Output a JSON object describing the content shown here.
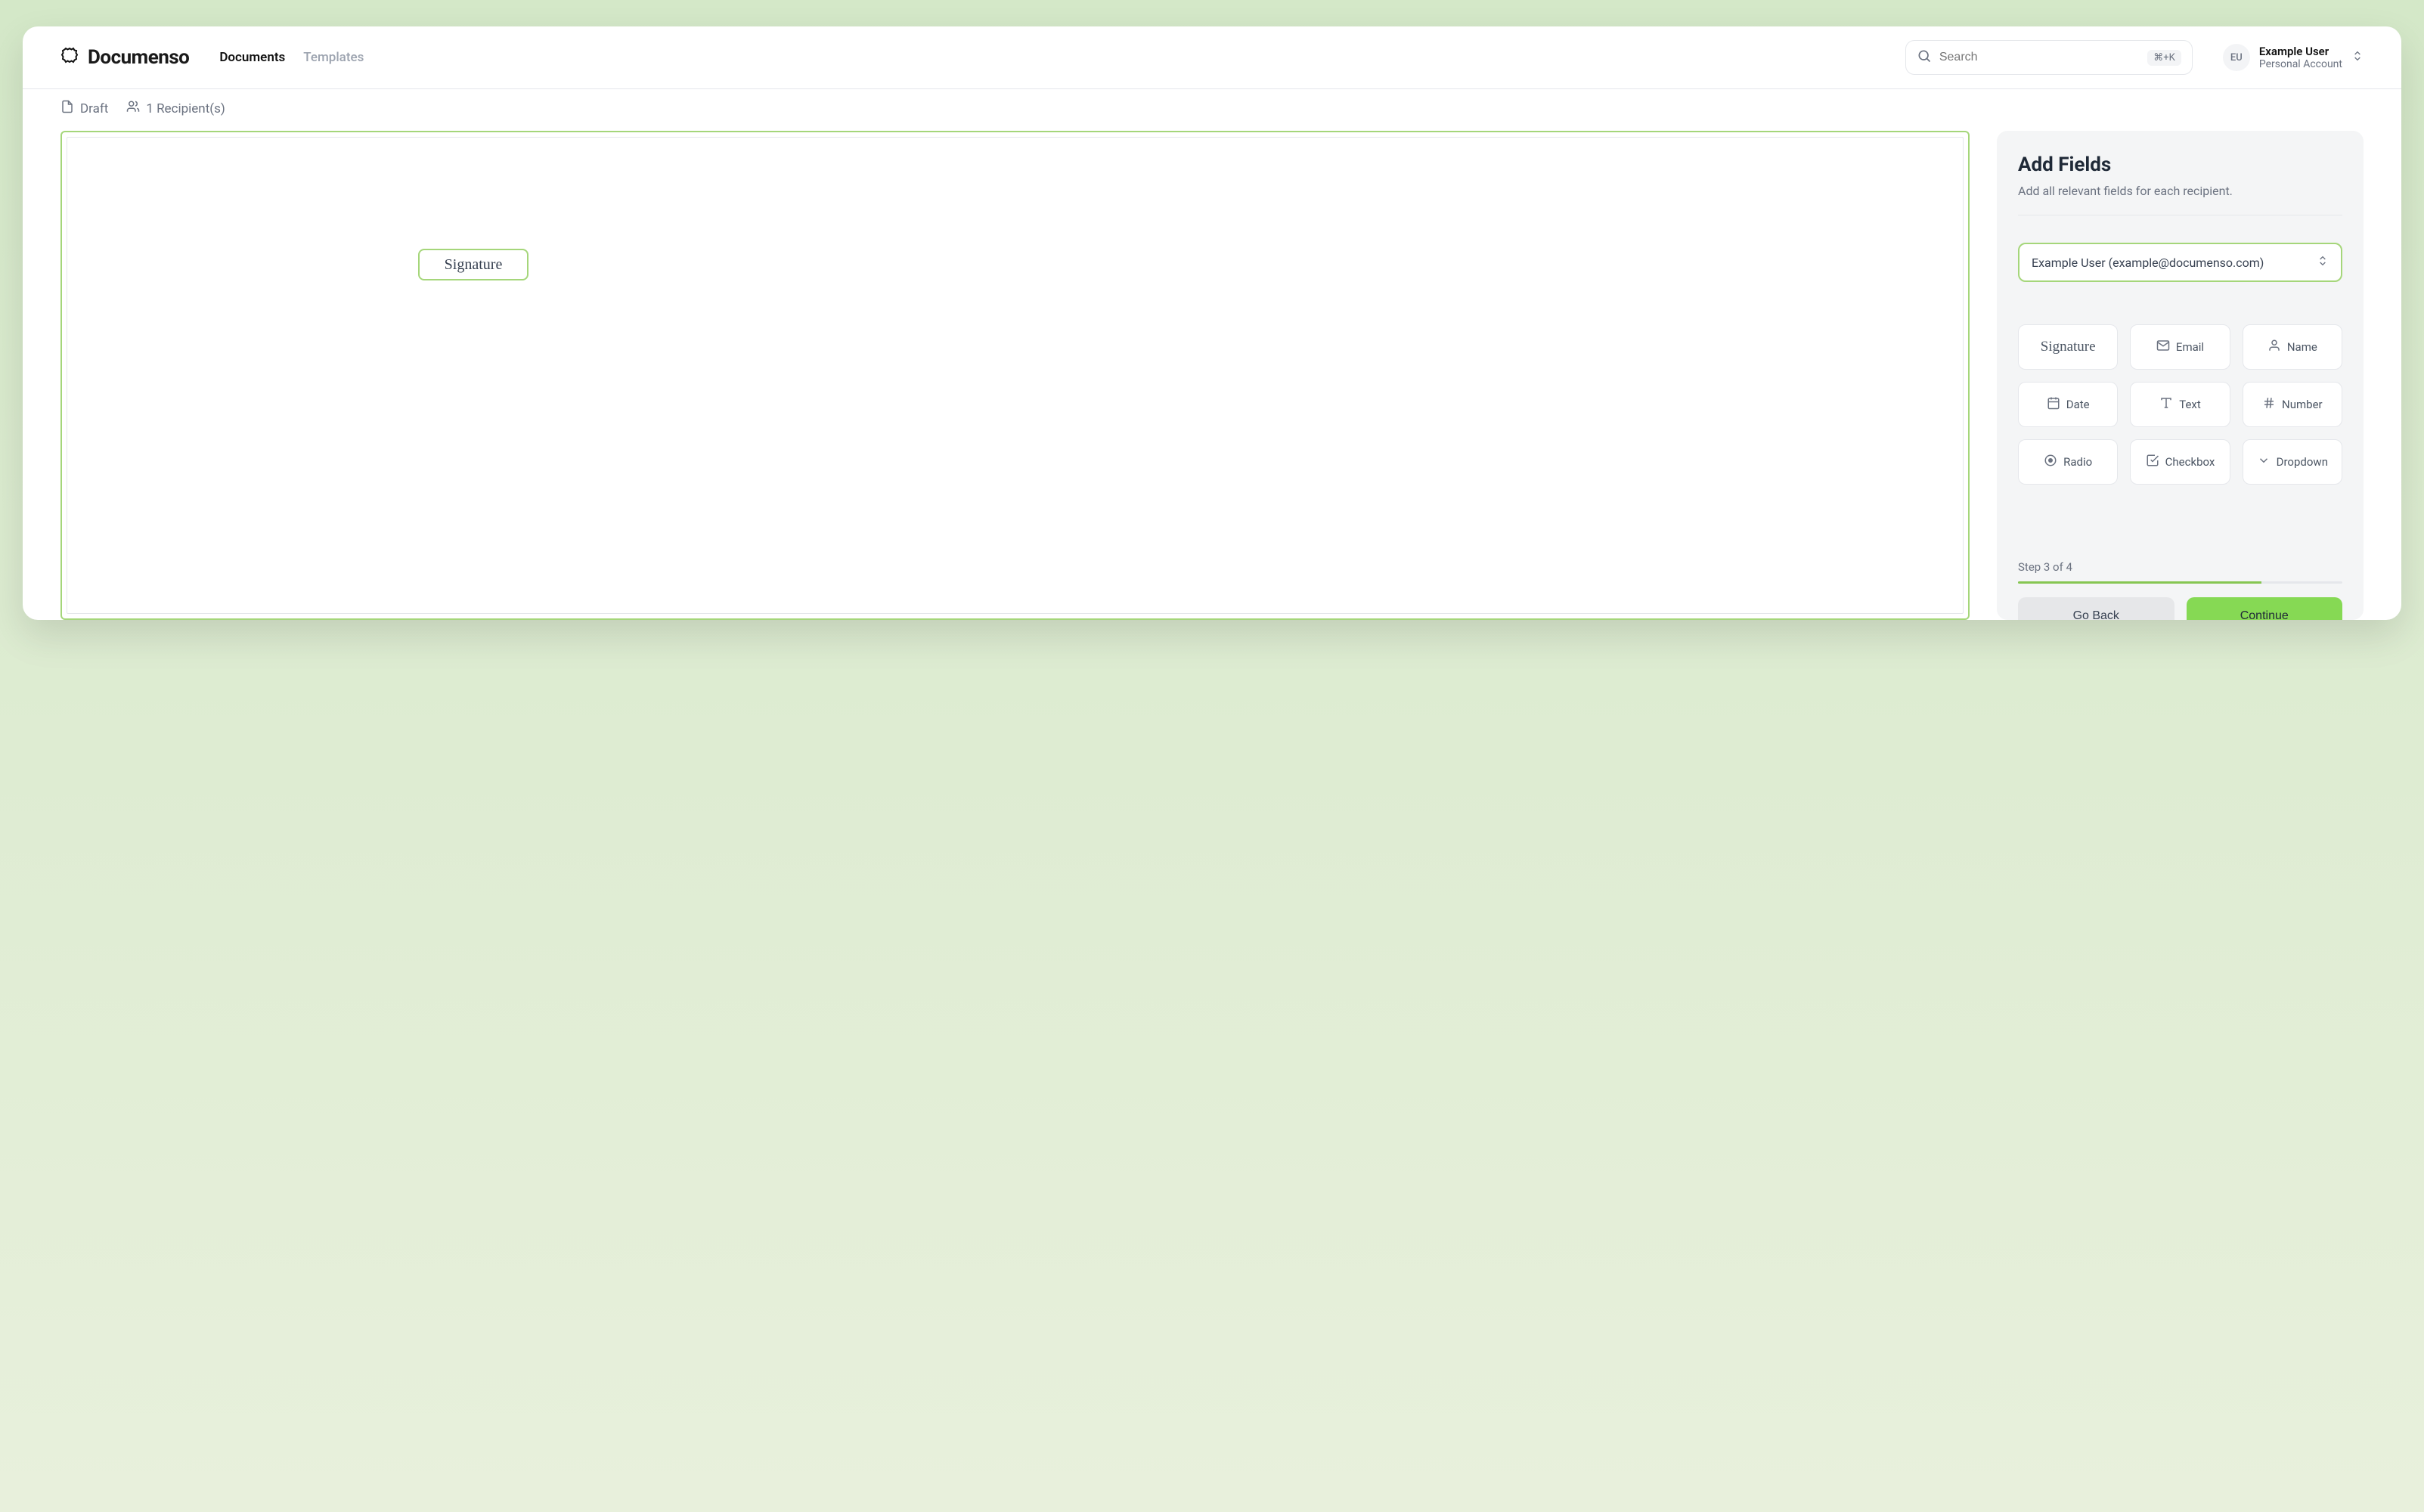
{
  "brand": "Documenso",
  "nav": {
    "documents": "Documents",
    "templates": "Templates"
  },
  "search": {
    "placeholder": "Search",
    "shortcut": "⌘+K"
  },
  "user": {
    "initials": "EU",
    "name": "Example User",
    "account": "Personal Account"
  },
  "meta": {
    "status": "Draft",
    "recipients": "1 Recipient(s)"
  },
  "document": {
    "placed_field": "Signature"
  },
  "sidebar": {
    "title": "Add Fields",
    "subtitle": "Add all relevant fields for each recipient.",
    "recipient": "Example User (example@documenso.com)",
    "fields": {
      "signature": "Signature",
      "email": "Email",
      "name": "Name",
      "date": "Date",
      "text": "Text",
      "number": "Number",
      "radio": "Radio",
      "checkbox": "Checkbox",
      "dropdown": "Dropdown"
    },
    "step": "Step 3 of 4",
    "back": "Go Back",
    "continue": "Continue"
  }
}
